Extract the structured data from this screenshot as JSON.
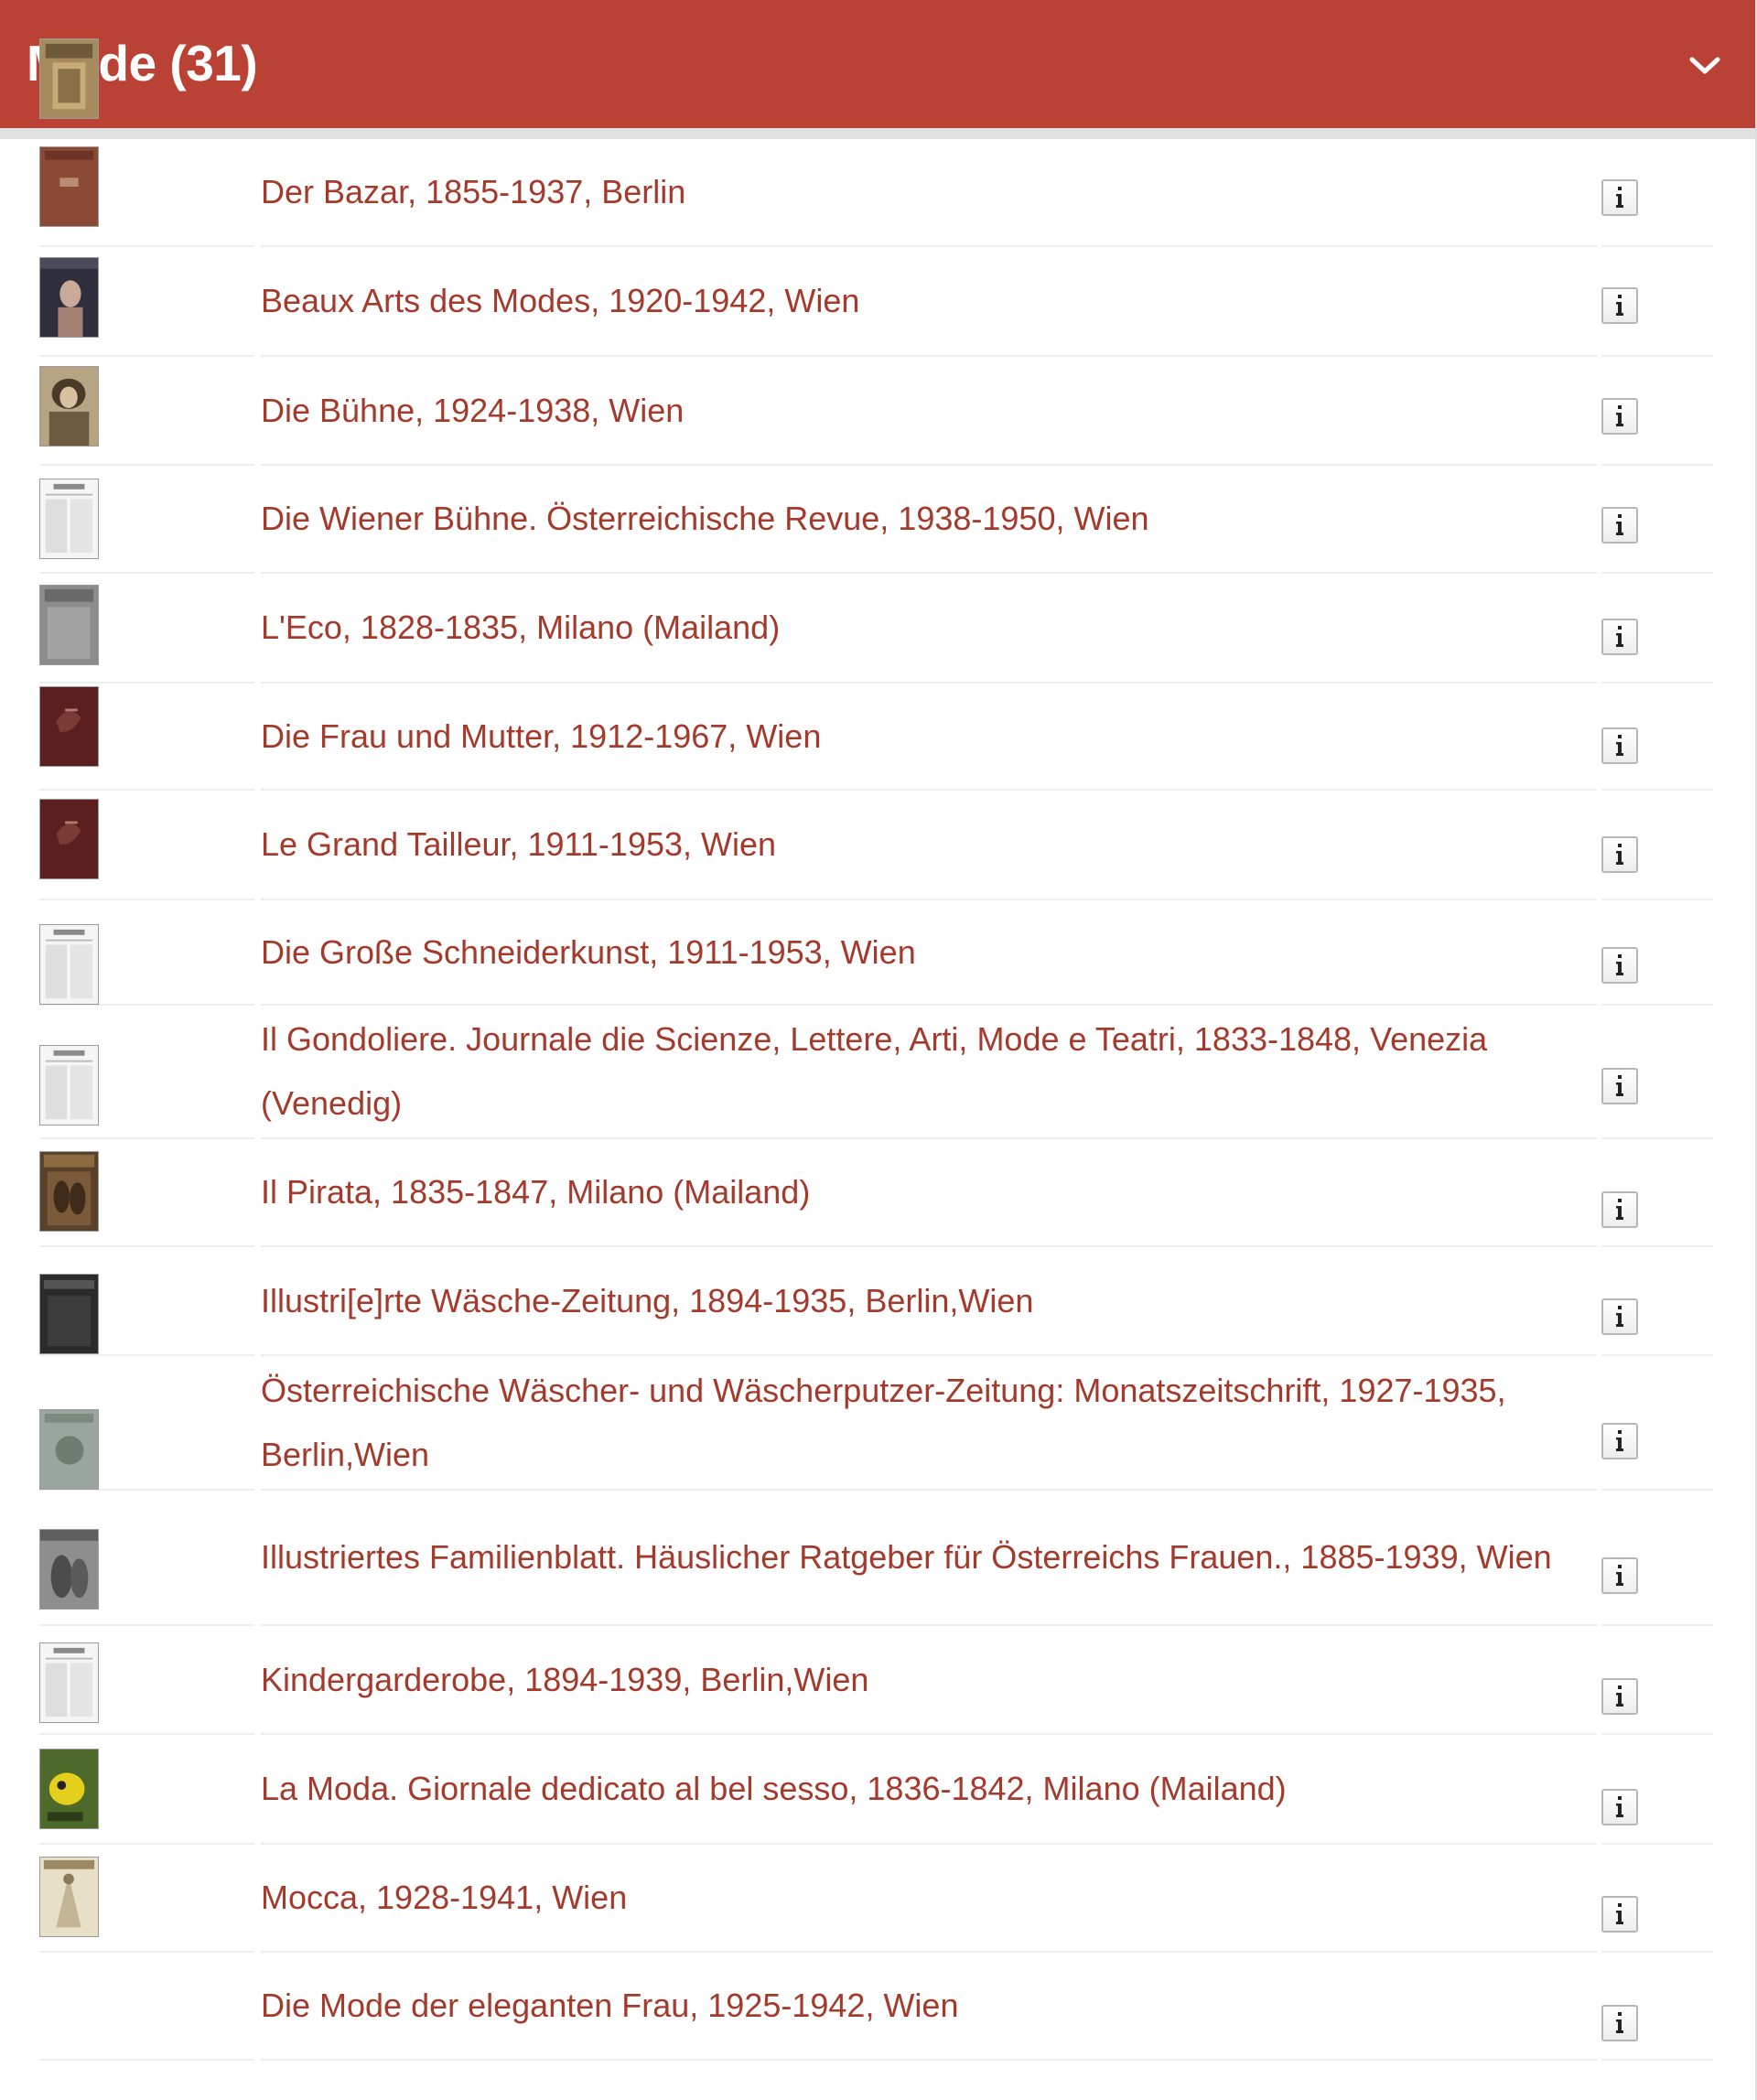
{
  "header": {
    "title": "Mode (31)",
    "toggle_icon": "chevron-down-icon",
    "background": "#b94234"
  },
  "colors": {
    "link": "#a33a2c",
    "divider": "#eeeeee",
    "info_border": "#b6b6b6"
  },
  "info_icon": "info-icon",
  "items": [
    {
      "title": "Der Bazar, 1855-1937, Berlin",
      "thumb": "cover-sepia"
    },
    {
      "title": "Beaux Arts des Modes, 1920-1942, Wien",
      "thumb": "cover-brown"
    },
    {
      "title": "Die Bühne, 1924-1938, Wien",
      "thumb": "cover-portrait-dark"
    },
    {
      "title": "Die Wiener Bühne. Österreichische Revue, 1938-1950, Wien",
      "thumb": "cover-portrait-sepia"
    },
    {
      "title": "L'Eco, 1828-1835, Milano (Mailand)",
      "thumb": "page-newsprint"
    },
    {
      "title": "Die Frau und Mutter, 1912-1967, Wien",
      "thumb": "cover-grey"
    },
    {
      "title": "Le Grand Tailleur, 1911-1953, Wien",
      "thumb": "cover-maroon"
    },
    {
      "title": "Die Große Schneiderkunst, 1911-1953, Wien",
      "thumb": "cover-maroon"
    },
    {
      "title": "Il Gondoliere. Journale die Scienze, Lettere, Arti, Mode e Teatri, 1833-1848, Venezia (Venedig)",
      "thumb": "page-newsprint"
    },
    {
      "title": "Il Pirata, 1835-1847, Milano (Mailand)",
      "thumb": "page-newsprint"
    },
    {
      "title": "Illustri[e]rte Wäsche-Zeitung, 1894-1935, Berlin,Wien",
      "thumb": "cover-illustrated-sepia"
    },
    {
      "title": "Österreichische Wäscher- und Wäscherputzer-Zeitung: Monatszeitschrift, 1927-1935, Berlin,Wien",
      "thumb": "cover-black"
    },
    {
      "title": "Illustriertes Familienblatt. Häuslicher Ratgeber für Österreichs Frauen., 1885-1939, Wien",
      "thumb": "cover-greygreen"
    },
    {
      "title": "Kindergarderobe, 1894-1939, Berlin,Wien",
      "thumb": "cover-grey-illustrated"
    },
    {
      "title": "La Moda. Giornale dedicato al bel sesso, 1836-1842, Milano (Mailand)",
      "thumb": "page-newsprint"
    },
    {
      "title": "Mocca, 1928-1941, Wien",
      "thumb": "cover-green-yellow"
    },
    {
      "title": "Die Mode der eleganten Frau, 1925-1942, Wien",
      "thumb": "cover-cream-figure"
    }
  ]
}
